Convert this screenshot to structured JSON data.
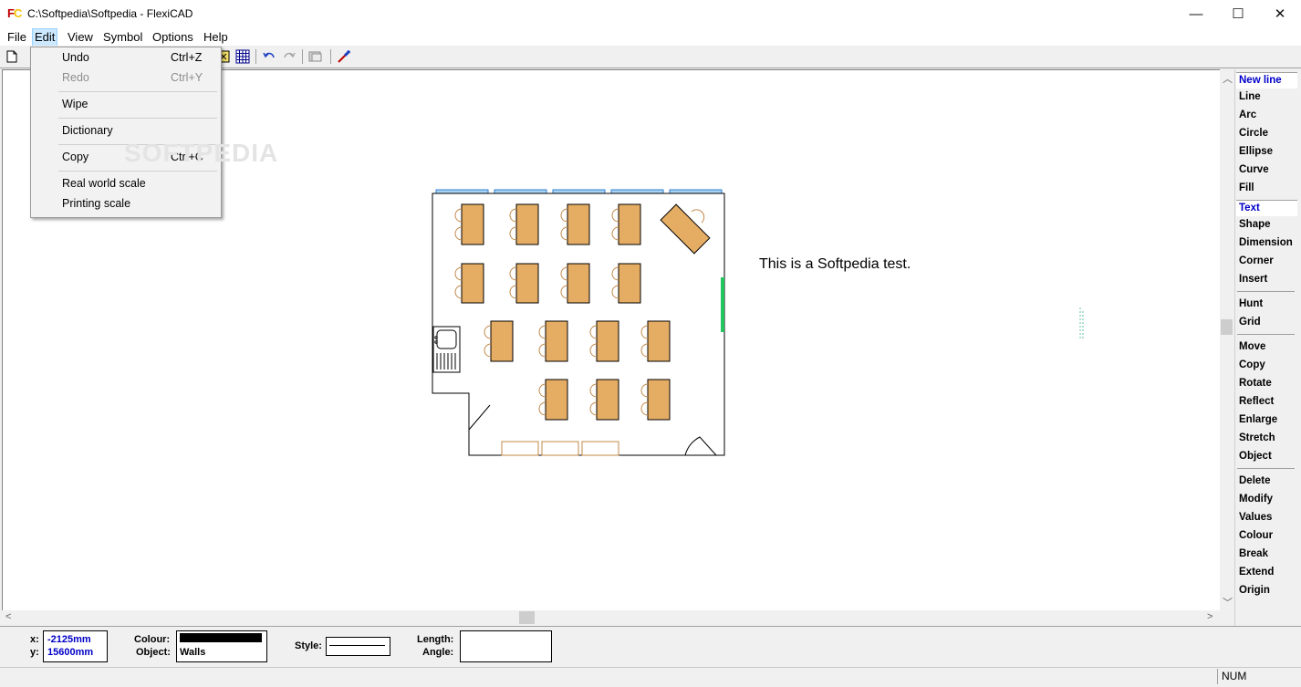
{
  "window": {
    "title": "C:\\Softpedia\\Softpedia - FlexiCAD",
    "minimize": "—",
    "maximize": "☐",
    "close": "✕"
  },
  "menu": [
    "File",
    "Edit",
    "View",
    "Symbol",
    "Options",
    "Help"
  ],
  "edit_menu": {
    "items": [
      {
        "label": "Undo",
        "shortcut": "Ctrl+Z",
        "enabled": true
      },
      {
        "label": "Redo",
        "shortcut": "Ctrl+Y",
        "enabled": false
      },
      {
        "label": "Wipe",
        "shortcut": "",
        "enabled": true
      },
      {
        "label": "Dictionary",
        "shortcut": "",
        "enabled": true
      },
      {
        "label": "Copy",
        "shortcut": "Ctrl+C",
        "enabled": true
      },
      {
        "label": "Real world scale",
        "shortcut": "",
        "enabled": true
      },
      {
        "label": "Printing scale",
        "shortcut": "",
        "enabled": true
      }
    ]
  },
  "watermark": "SOFTPEDIA",
  "drawing": {
    "text_label": "This is a Softpedia test."
  },
  "tools": {
    "new_line": "New line",
    "line": "Line",
    "arc": "Arc",
    "circle": "Circle",
    "ellipse": "Ellipse",
    "curve": "Curve",
    "fill": "Fill",
    "text": "Text",
    "shape": "Shape",
    "dimension": "Dimension",
    "corner": "Corner",
    "insert": "Insert",
    "hunt": "Hunt",
    "grid": "Grid",
    "move": "Move",
    "copy": "Copy",
    "rotate": "Rotate",
    "reflect": "Reflect",
    "enlarge": "Enlarge",
    "stretch": "Stretch",
    "object": "Object",
    "delete": "Delete",
    "modify": "Modify",
    "values": "Values",
    "colour": "Colour",
    "break": "Break",
    "extend": "Extend",
    "origin": "Origin"
  },
  "selected_tools": [
    "New line",
    "Text"
  ],
  "info": {
    "x_label": "x:",
    "x_value": "-2125mm",
    "y_label": "y:",
    "y_value": "15600mm",
    "colour_label": "Colour:",
    "colour_value": "#000000",
    "object_label": "Object:",
    "object_value": "Walls",
    "style_label": "Style:",
    "length_label": "Length:",
    "angle_label": "Angle:"
  },
  "status": {
    "num": "NUM"
  },
  "colors": {
    "desk": "#e5ad63",
    "window": "#a9d3f5",
    "door_green": "#22c55e",
    "selected_text": "#0000c8"
  }
}
